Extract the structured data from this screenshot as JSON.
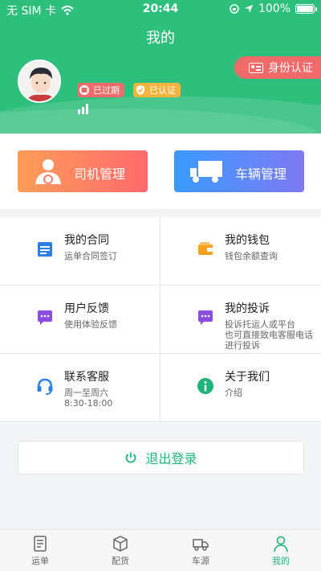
{
  "status": {
    "carrier": "无 SIM 卡",
    "time": "20:44",
    "battery": "100%"
  },
  "header": {
    "title": "我的",
    "badges": {
      "expired": "已过期",
      "verified": "已认证"
    },
    "id_verify_label": "身份认证"
  },
  "management": {
    "driver_label": "司机管理",
    "vehicle_label": "车辆管理"
  },
  "grid": {
    "contract": {
      "title": "我的合同",
      "desc": "运单合同签订"
    },
    "wallet": {
      "title": "我的钱包",
      "desc": "钱包余额查询"
    },
    "feedback": {
      "title": "用户反馈",
      "desc": "使用体验反馈"
    },
    "complaint": {
      "title": "我的投诉",
      "desc": "投诉托运人或平台\n也可直接致电客服电话\n进行投诉"
    },
    "service": {
      "title": "联系客服",
      "desc": "周一至周六\n8:30-18:00"
    },
    "about": {
      "title": "关于我们",
      "desc": "介绍"
    }
  },
  "logout_label": "退出登录",
  "tabs": [
    {
      "label": "运单",
      "icon": "waybill-icon"
    },
    {
      "label": "配货",
      "icon": "box-icon"
    },
    {
      "label": "车源",
      "icon": "truck-icon"
    },
    {
      "label": "我的",
      "icon": "person-icon"
    }
  ],
  "colors": {
    "brand_green": "#2fbf7d",
    "active_green": "#21b478",
    "red": "#f06a6a",
    "amber": "#f4b33d",
    "driver_gradient": [
      "#ff9d57",
      "#ff6a6e"
    ],
    "vehicle_gradient": [
      "#3a9bff",
      "#7e79f2"
    ]
  }
}
